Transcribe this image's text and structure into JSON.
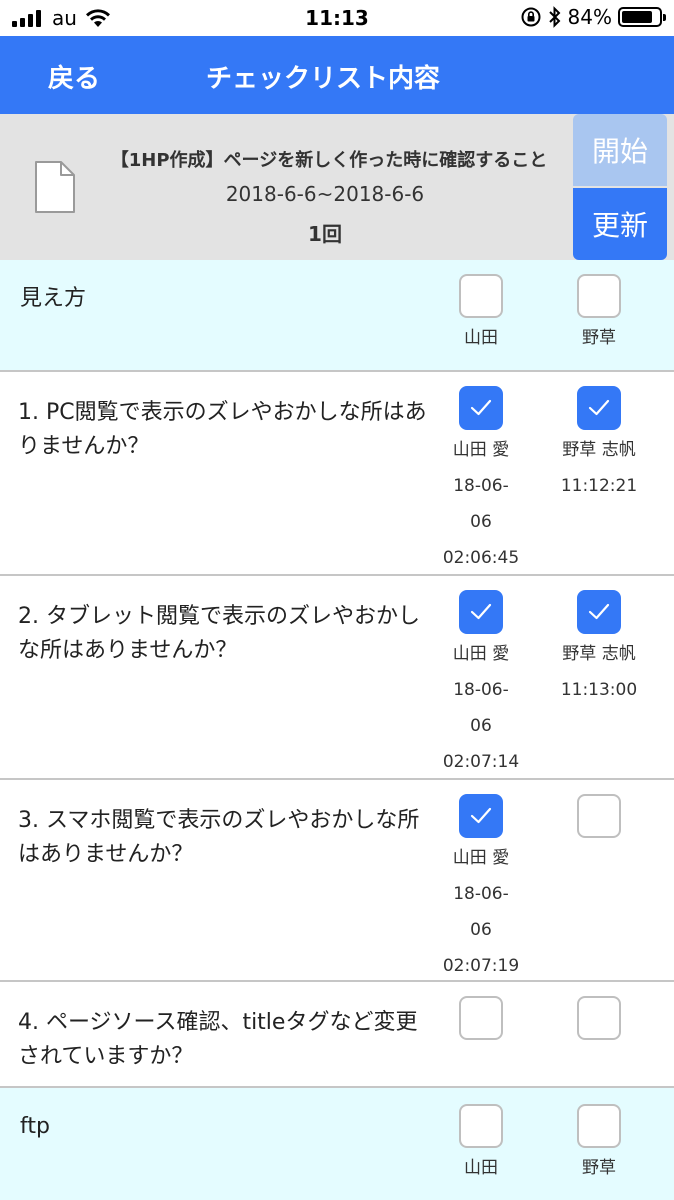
{
  "status": {
    "carrier": "au",
    "time": "11:13",
    "battery_text": "84%",
    "battery_level": 0.84
  },
  "nav": {
    "back_label": "戻る",
    "title": "チェックリスト内容"
  },
  "header": {
    "title": "【1HP作成】ページを新しく作った時に確認すること",
    "period": "2018-6-6~2018-6-6",
    "count": "1回",
    "start_label": "開始",
    "update_label": "更新"
  },
  "sections": [
    {
      "label": "見え方",
      "users": [
        "山田",
        "野草"
      ],
      "items": [
        {
          "text": "1. PC閲覧で表示のズレやおかしな所はありませんか？",
          "checks": [
            {
              "checked": true,
              "name": "山田 愛",
              "date1": "18-06-",
              "date2": "06",
              "time": "02:06:45"
            },
            {
              "checked": true,
              "name": "野草 志帆",
              "date1": "11:12:21",
              "date2": "",
              "time": ""
            }
          ]
        },
        {
          "text": "2. タブレット閲覧で表示のズレやおかしな所はありませんか？",
          "checks": [
            {
              "checked": true,
              "name": "山田 愛",
              "date1": "18-06-",
              "date2": "06",
              "time": "02:07:14"
            },
            {
              "checked": true,
              "name": "野草 志帆",
              "date1": "11:13:00",
              "date2": "",
              "time": ""
            }
          ]
        },
        {
          "text": "3. スマホ閲覧で表示のズレやおかしな所はありませんか？",
          "checks": [
            {
              "checked": true,
              "name": "山田 愛",
              "date1": "18-06-",
              "date2": "06",
              "time": "02:07:19"
            },
            {
              "checked": false,
              "name": "",
              "date1": "",
              "date2": "",
              "time": ""
            }
          ]
        },
        {
          "text": "4. ページソース確認、titleタグなど変更されていますか？",
          "checks": [
            {
              "checked": false,
              "name": "",
              "date1": "",
              "date2": "",
              "time": ""
            },
            {
              "checked": false,
              "name": "",
              "date1": "",
              "date2": "",
              "time": ""
            }
          ]
        }
      ]
    },
    {
      "label": "ftp",
      "users": [
        "山田",
        "野草"
      ],
      "items": []
    }
  ],
  "colors": {
    "accent": "#3478f6",
    "accent_disabled": "#a9c6f0",
    "section_bg": "#e4fcff",
    "header_bg": "#e3e3e3"
  }
}
